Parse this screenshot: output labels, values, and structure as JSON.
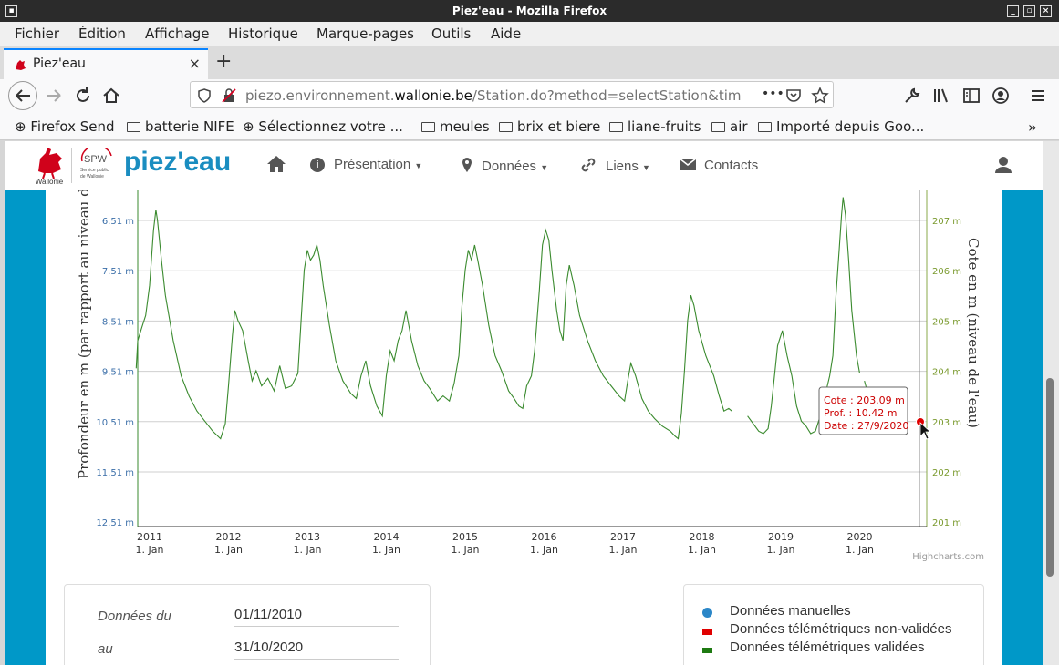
{
  "window": {
    "title": "Piez'eau - Mozilla Firefox"
  },
  "menubar": [
    "Fichier",
    "Édition",
    "Affichage",
    "Historique",
    "Marque-pages",
    "Outils",
    "Aide"
  ],
  "tab": {
    "title": "Piez'eau",
    "close": "×",
    "new": "+"
  },
  "url": {
    "prefix": "piezo.environnement.",
    "domain": "wallonie.be",
    "path": "/Station.do?method=selectStation&tim",
    "more": "•••"
  },
  "bookmarks": [
    "Firefox Send",
    "batterie NIFE",
    "Sélectionnez votre ...",
    "meules",
    "brix et biere",
    "liane-fruits",
    "air",
    "Importé depuis Goo..."
  ],
  "site": {
    "brand": "piez'eau",
    "logo_text": "Wallonie",
    "spw_text": "SPW",
    "spw_sub1": "Service public",
    "spw_sub2": "de Wallonie",
    "nav": [
      "Présentation",
      "Données",
      "Liens",
      "Contacts"
    ]
  },
  "chart_data": {
    "type": "line",
    "ylabel_left": "Profondeur en m (par rapport au niveau du s",
    "ylabel_right": "Cote en m (niveau de l'eau)",
    "y_left_ticks": [
      "6.51 m",
      "7.51 m",
      "8.51 m",
      "9.51 m",
      "10.51 m",
      "11.51 m",
      "12.51 m"
    ],
    "y_right_ticks": [
      "207 m",
      "206 m",
      "205 m",
      "204 m",
      "203 m",
      "202 m",
      "201 m"
    ],
    "x_ticks": [
      {
        "year": "2011",
        "sub": "1. Jan"
      },
      {
        "year": "2012",
        "sub": "1. Jan"
      },
      {
        "year": "2013",
        "sub": "1. Jan"
      },
      {
        "year": "2014",
        "sub": "1. Jan"
      },
      {
        "year": "2015",
        "sub": "1. Jan"
      },
      {
        "year": "2016",
        "sub": "1. Jan"
      },
      {
        "year": "2017",
        "sub": "1. Jan"
      },
      {
        "year": "2018",
        "sub": "1. Jan"
      },
      {
        "year": "2019",
        "sub": "1. Jan"
      },
      {
        "year": "2020",
        "sub": "1. Jan"
      }
    ],
    "xlim": [
      2010.85,
      2020.85
    ],
    "ylim_depth": [
      12.51,
      5.88
    ],
    "series": [
      {
        "color": "#3a8a2e",
        "points": [
          [
            2010.83,
            9.45
          ],
          [
            2010.85,
            8.9
          ],
          [
            2010.9,
            8.65
          ],
          [
            2010.95,
            8.4
          ],
          [
            2011.0,
            7.8
          ],
          [
            2011.05,
            6.7
          ],
          [
            2011.08,
            6.3
          ],
          [
            2011.1,
            6.5
          ],
          [
            2011.15,
            7.3
          ],
          [
            2011.2,
            8.0
          ],
          [
            2011.3,
            8.9
          ],
          [
            2011.4,
            9.6
          ],
          [
            2011.5,
            10.0
          ],
          [
            2011.6,
            10.3
          ],
          [
            2011.7,
            10.5
          ],
          [
            2011.8,
            10.7
          ],
          [
            2011.9,
            10.85
          ],
          [
            2011.96,
            10.55
          ],
          [
            2012.0,
            9.8
          ],
          [
            2012.05,
            8.8
          ],
          [
            2012.08,
            8.3
          ],
          [
            2012.12,
            8.5
          ],
          [
            2012.18,
            8.7
          ],
          [
            2012.25,
            9.3
          ],
          [
            2012.3,
            9.7
          ],
          [
            2012.35,
            9.5
          ],
          [
            2012.42,
            9.8
          ],
          [
            2012.5,
            9.65
          ],
          [
            2012.58,
            9.9
          ],
          [
            2012.65,
            9.4
          ],
          [
            2012.72,
            9.85
          ],
          [
            2012.8,
            9.8
          ],
          [
            2012.88,
            9.55
          ],
          [
            2012.92,
            8.5
          ],
          [
            2012.96,
            7.5
          ],
          [
            2013.0,
            7.1
          ],
          [
            2013.04,
            7.3
          ],
          [
            2013.08,
            7.2
          ],
          [
            2013.12,
            7.0
          ],
          [
            2013.16,
            7.3
          ],
          [
            2013.2,
            7.8
          ],
          [
            2013.28,
            8.6
          ],
          [
            2013.36,
            9.3
          ],
          [
            2013.45,
            9.7
          ],
          [
            2013.55,
            9.95
          ],
          [
            2013.62,
            10.05
          ],
          [
            2013.68,
            9.6
          ],
          [
            2013.74,
            9.3
          ],
          [
            2013.8,
            9.8
          ],
          [
            2013.88,
            10.2
          ],
          [
            2013.95,
            10.4
          ],
          [
            2014.0,
            9.6
          ],
          [
            2014.05,
            9.1
          ],
          [
            2014.1,
            9.3
          ],
          [
            2014.15,
            8.9
          ],
          [
            2014.2,
            8.7
          ],
          [
            2014.25,
            8.3
          ],
          [
            2014.32,
            8.9
          ],
          [
            2014.4,
            9.4
          ],
          [
            2014.48,
            9.7
          ],
          [
            2014.55,
            9.85
          ],
          [
            2014.65,
            10.1
          ],
          [
            2014.72,
            10.0
          ],
          [
            2014.8,
            10.1
          ],
          [
            2014.86,
            9.75
          ],
          [
            2014.92,
            9.2
          ],
          [
            2014.96,
            8.2
          ],
          [
            2015.0,
            7.5
          ],
          [
            2015.04,
            7.1
          ],
          [
            2015.08,
            7.3
          ],
          [
            2015.12,
            7.0
          ],
          [
            2015.16,
            7.3
          ],
          [
            2015.22,
            7.8
          ],
          [
            2015.3,
            8.6
          ],
          [
            2015.38,
            9.2
          ],
          [
            2015.46,
            9.5
          ],
          [
            2015.55,
            9.9
          ],
          [
            2015.62,
            10.05
          ],
          [
            2015.68,
            10.2
          ],
          [
            2015.73,
            10.25
          ],
          [
            2015.78,
            9.8
          ],
          [
            2015.84,
            9.6
          ],
          [
            2015.88,
            9.1
          ],
          [
            2015.94,
            7.9
          ],
          [
            2015.98,
            7.0
          ],
          [
            2016.02,
            6.7
          ],
          [
            2016.06,
            6.9
          ],
          [
            2016.1,
            7.5
          ],
          [
            2016.16,
            8.3
          ],
          [
            2016.2,
            8.7
          ],
          [
            2016.24,
            8.9
          ],
          [
            2016.28,
            7.8
          ],
          [
            2016.32,
            7.4
          ],
          [
            2016.38,
            7.8
          ],
          [
            2016.45,
            8.4
          ],
          [
            2016.55,
            8.9
          ],
          [
            2016.65,
            9.3
          ],
          [
            2016.75,
            9.6
          ],
          [
            2016.85,
            9.8
          ],
          [
            2016.95,
            10.0
          ],
          [
            2017.02,
            10.1
          ],
          [
            2017.06,
            9.7
          ],
          [
            2017.1,
            9.35
          ],
          [
            2017.16,
            9.6
          ],
          [
            2017.24,
            10.05
          ],
          [
            2017.32,
            10.3
          ],
          [
            2017.4,
            10.45
          ],
          [
            2017.5,
            10.6
          ],
          [
            2017.6,
            10.7
          ],
          [
            2017.66,
            10.8
          ],
          [
            2017.7,
            10.85
          ],
          [
            2017.74,
            10.35
          ],
          [
            2017.78,
            9.5
          ],
          [
            2017.82,
            8.5
          ],
          [
            2017.86,
            8.0
          ],
          [
            2017.9,
            8.2
          ],
          [
            2017.96,
            8.7
          ],
          [
            2018.05,
            9.2
          ],
          [
            2018.15,
            9.6
          ],
          [
            2018.22,
            10.0
          ],
          [
            2018.28,
            10.3
          ],
          [
            2018.34,
            10.25
          ],
          [
            2018.38,
            10.3
          ]
        ],
        "points2": [
          [
            2018.58,
            10.4
          ],
          [
            2018.65,
            10.55
          ],
          [
            2018.72,
            10.7
          ],
          [
            2018.78,
            10.75
          ],
          [
            2018.84,
            10.65
          ],
          [
            2018.88,
            10.2
          ],
          [
            2018.92,
            9.6
          ],
          [
            2018.96,
            9.0
          ],
          [
            2019.02,
            8.7
          ],
          [
            2019.08,
            9.2
          ],
          [
            2019.14,
            9.6
          ],
          [
            2019.2,
            10.2
          ],
          [
            2019.26,
            10.5
          ],
          [
            2019.32,
            10.6
          ],
          [
            2019.38,
            10.75
          ],
          [
            2019.44,
            10.7
          ],
          [
            2019.5,
            10.4
          ],
          [
            2019.56,
            10.0
          ],
          [
            2019.62,
            9.6
          ],
          [
            2019.66,
            9.2
          ],
          [
            2019.7,
            8.0
          ],
          [
            2019.74,
            7.1
          ],
          [
            2019.77,
            6.4
          ],
          [
            2019.79,
            6.05
          ],
          [
            2019.82,
            6.4
          ],
          [
            2019.86,
            7.3
          ],
          [
            2019.9,
            8.3
          ],
          [
            2019.96,
            9.2
          ],
          [
            2020.0,
            9.55
          ]
        ],
        "points3": [
          [
            2020.06,
            9.7
          ],
          [
            2020.12,
            10.05
          ],
          [
            2020.18,
            10.35
          ],
          [
            2020.26,
            10.42
          ]
        ]
      }
    ],
    "tooltip": {
      "cote": "Cote : 203.09 m",
      "prof": "Prof. : 10.42 m",
      "date": "Date : 27/9/2020"
    },
    "credits": "Highcharts.com"
  },
  "form": {
    "from_label": "Données du",
    "from_value": "01/11/2010",
    "to_label": "au",
    "to_value": "31/10/2020"
  },
  "legend": [
    {
      "label": "Données manuelles",
      "color": "#2b87c8",
      "shape": "circle"
    },
    {
      "label": "Données télémétriques non-validées",
      "color": "#e00000",
      "shape": "bar"
    },
    {
      "label": "Données télémétriques validées",
      "color": "#1e7a12",
      "shape": "bar"
    }
  ]
}
